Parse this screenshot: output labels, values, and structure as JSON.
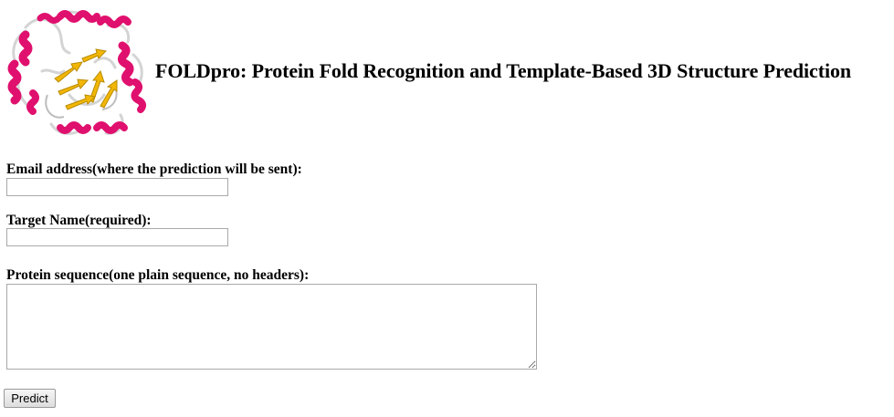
{
  "page": {
    "title": "FOLDpro: Protein Fold Recognition and Template-Based 3D Structure Prediction"
  },
  "logo": {
    "icon": "protein-structure-icon",
    "colors": {
      "helix": "#e0106e",
      "sheet": "#f2b705",
      "loop": "#d6d6d6"
    }
  },
  "form": {
    "email_label": "Email address(where the prediction will be sent):",
    "email_value": "",
    "target_label": "Target Name(required):",
    "target_value": "",
    "sequence_label": "Protein sequence(one plain sequence, no headers):",
    "sequence_value": "",
    "submit_label": "Predict"
  }
}
